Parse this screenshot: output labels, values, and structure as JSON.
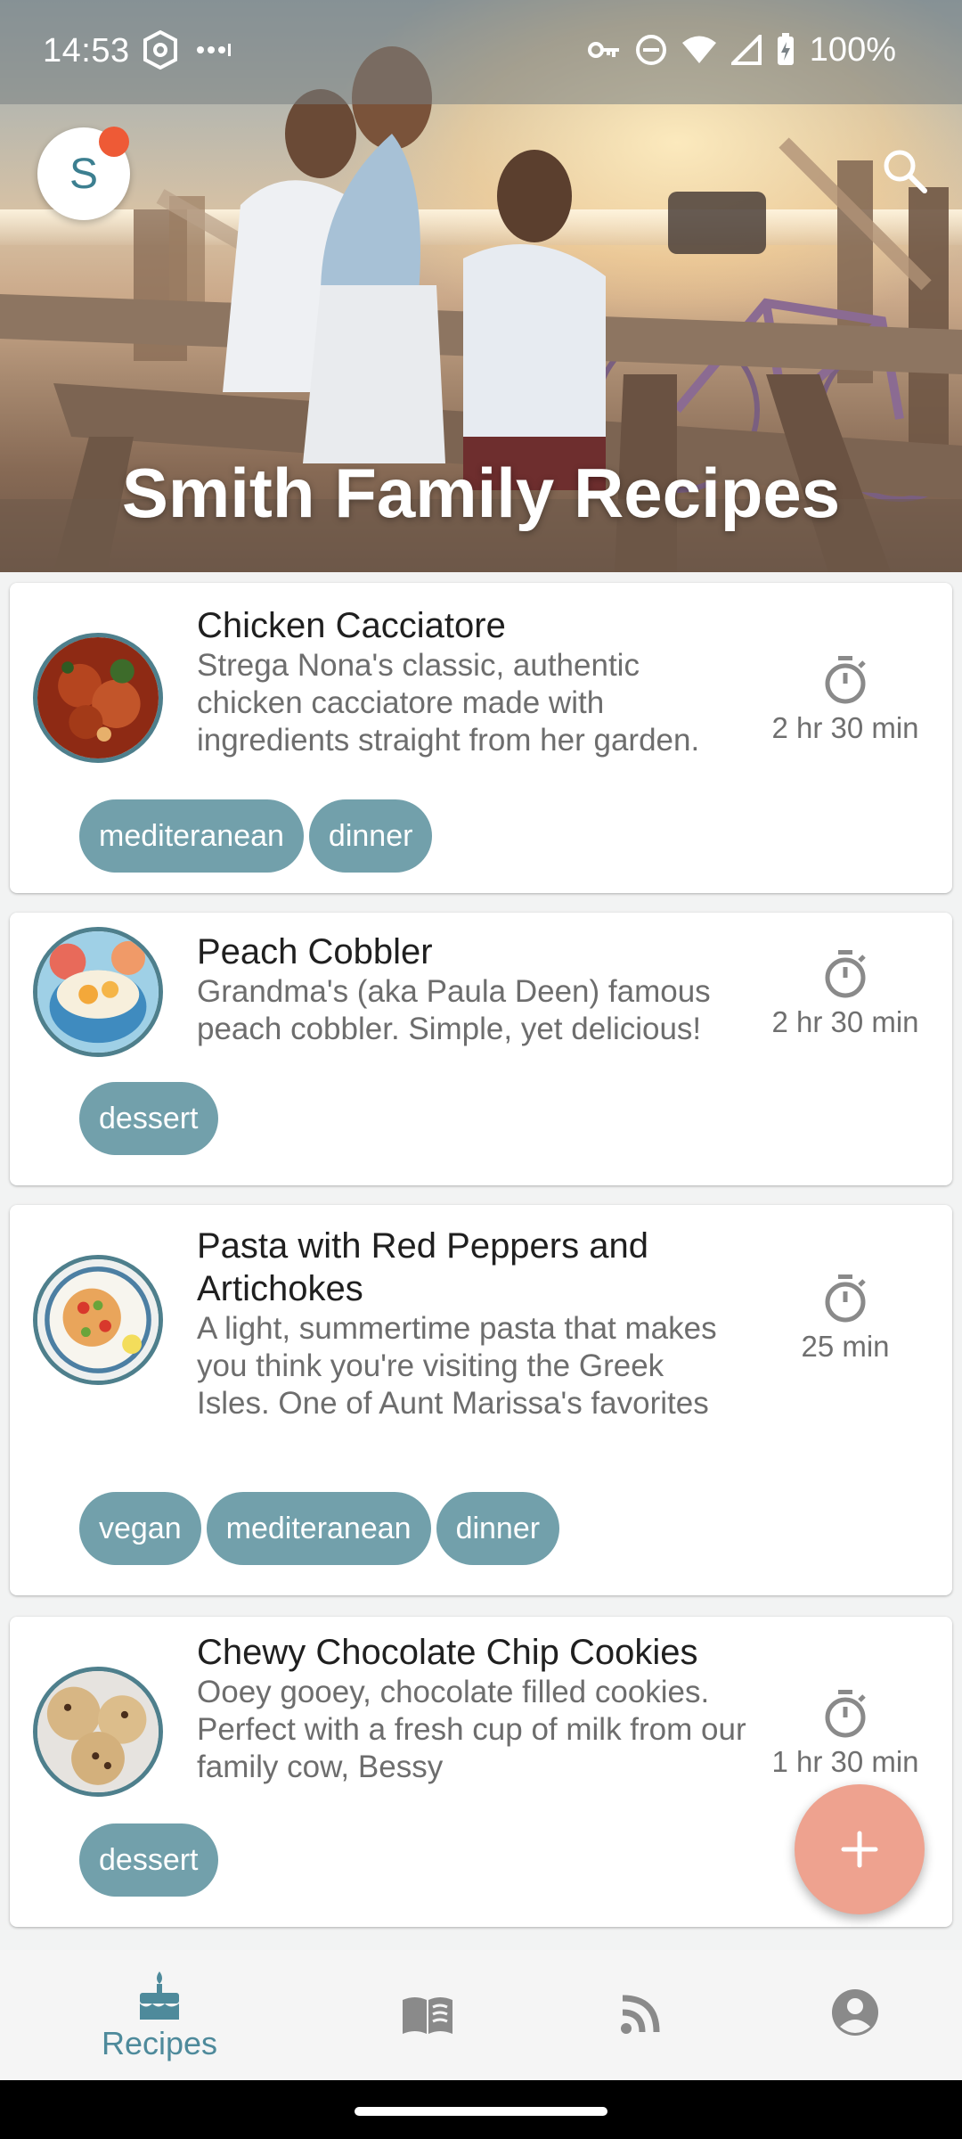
{
  "status_bar": {
    "time": "14:53",
    "battery_text": "100%",
    "icons": [
      "shield-hex-icon",
      "more-dots-icon",
      "vpn-key-icon",
      "do-not-disturb-icon",
      "wifi-icon",
      "signal-icon",
      "battery-charging-icon"
    ]
  },
  "header": {
    "avatar_letter": "S",
    "title": "Smith Family Recipes",
    "search_icon": "search-icon"
  },
  "recipes": [
    {
      "title": "Chicken Cacciatore",
      "description": "Strega Nona's classic, authentic chicken cacciatore made with ingredients straight from her garden.",
      "time": "2 hr 30 min",
      "tags": [
        "mediteranean",
        "dinner"
      ]
    },
    {
      "title": "Peach Cobbler",
      "description": "Grandma's (aka Paula Deen) famous peach cobbler. Simple, yet delicious!",
      "time": "2 hr 30 min",
      "tags": [
        "dessert"
      ]
    },
    {
      "title": "Pasta with Red Peppers and Artichokes",
      "description": "A light, summertime pasta that makes you think you're visiting the Greek Isles. One of Aunt Marissa's favorites",
      "time": "25 min",
      "tags": [
        "vegan",
        "mediteranean",
        "dinner"
      ]
    },
    {
      "title": "Chewy Chocolate Chip Cookies",
      "description": "Ooey gooey, chocolate filled cookies. Perfect with a fresh cup of milk from our family cow, Bessy",
      "time": "1 hr 30 min",
      "tags": [
        "dessert"
      ]
    }
  ],
  "fab": {
    "icon": "plus-icon"
  },
  "bottom_nav": {
    "items": [
      {
        "label": "Recipes",
        "icon": "cake-icon",
        "active": true
      },
      {
        "label": "",
        "icon": "book-icon",
        "active": false
      },
      {
        "label": "",
        "icon": "rss-feed-icon",
        "active": false
      },
      {
        "label": "",
        "icon": "account-circle-icon",
        "active": false
      }
    ]
  },
  "colors": {
    "accent": "#4e8a9b",
    "tag_bg": "#72a0ab",
    "fab_bg": "#eea28f",
    "notification_dot": "#ee5a36"
  }
}
